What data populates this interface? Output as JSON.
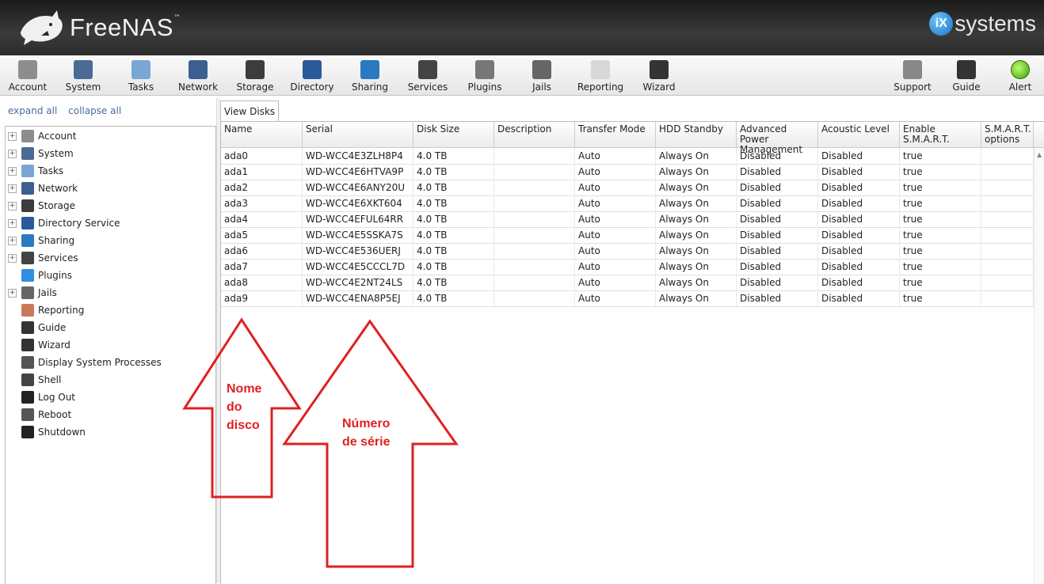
{
  "header": {
    "app_name": "FreeNAS",
    "tm": "™",
    "vendor_mark": "iX",
    "vendor_text": "systems"
  },
  "toolbar": {
    "items": [
      {
        "label": "Account",
        "icon": "account-icon",
        "color": "#8d8d8d"
      },
      {
        "label": "System",
        "icon": "system-icon",
        "color": "#4b6b95"
      },
      {
        "label": "Tasks",
        "icon": "tasks-icon",
        "color": "#7aa6d6"
      },
      {
        "label": "Network",
        "icon": "network-icon",
        "color": "#3d5f8f"
      },
      {
        "label": "Storage",
        "icon": "storage-icon",
        "color": "#3c3c3c"
      },
      {
        "label": "Directory",
        "icon": "directory-icon",
        "color": "#2a5a9a"
      },
      {
        "label": "Sharing",
        "icon": "sharing-icon",
        "color": "#2a7abf"
      },
      {
        "label": "Services",
        "icon": "services-icon",
        "color": "#444444"
      },
      {
        "label": "Plugins",
        "icon": "plugins-icon",
        "color": "#777777"
      },
      {
        "label": "Jails",
        "icon": "jails-icon",
        "color": "#666666"
      },
      {
        "label": "Reporting",
        "icon": "reporting-icon",
        "color": "#d8d8d8"
      },
      {
        "label": "Wizard",
        "icon": "wizard-icon",
        "color": "#333333"
      }
    ],
    "right_items": [
      {
        "label": "Support",
        "icon": "support-icon",
        "color": "#888888"
      },
      {
        "label": "Guide",
        "icon": "guide-icon",
        "color": "#333333"
      },
      {
        "label": "Alert",
        "icon": "alert-icon",
        "color": "#6cd02a"
      }
    ]
  },
  "tree": {
    "expand_all": "expand all",
    "collapse_all": "collapse all",
    "items": [
      {
        "label": "Account",
        "icon": "account-icon",
        "expandable": true,
        "color": "#8d8d8d"
      },
      {
        "label": "System",
        "icon": "system-icon",
        "expandable": true,
        "color": "#4b6b95"
      },
      {
        "label": "Tasks",
        "icon": "tasks-icon",
        "expandable": true,
        "color": "#7aa6d6"
      },
      {
        "label": "Network",
        "icon": "network-icon",
        "expandable": true,
        "color": "#3d5f8f"
      },
      {
        "label": "Storage",
        "icon": "storage-icon",
        "expandable": true,
        "color": "#3c3c3c"
      },
      {
        "label": "Directory Service",
        "icon": "directory-icon",
        "expandable": true,
        "color": "#2a5a9a"
      },
      {
        "label": "Sharing",
        "icon": "sharing-icon",
        "expandable": true,
        "color": "#2a7abf"
      },
      {
        "label": "Services",
        "icon": "services-icon",
        "expandable": true,
        "color": "#444444"
      },
      {
        "label": "Plugins",
        "icon": "plugins-icon",
        "expandable": false,
        "color": "#2f8fe0"
      },
      {
        "label": "Jails",
        "icon": "jails-icon",
        "expandable": true,
        "color": "#666666"
      },
      {
        "label": "Reporting",
        "icon": "reporting-icon",
        "expandable": false,
        "color": "#c97a5a"
      },
      {
        "label": "Guide",
        "icon": "guide-icon",
        "expandable": false,
        "color": "#333333"
      },
      {
        "label": "Wizard",
        "icon": "wizard-icon",
        "expandable": false,
        "color": "#333333"
      },
      {
        "label": "Display System Processes",
        "icon": "processes-icon",
        "expandable": false,
        "color": "#555555"
      },
      {
        "label": "Shell",
        "icon": "shell-icon",
        "expandable": false,
        "color": "#444444"
      },
      {
        "label": "Log Out",
        "icon": "logout-icon",
        "expandable": false,
        "color": "#222222"
      },
      {
        "label": "Reboot",
        "icon": "reboot-icon",
        "expandable": false,
        "color": "#555555"
      },
      {
        "label": "Shutdown",
        "icon": "shutdown-icon",
        "expandable": false,
        "color": "#222222"
      }
    ]
  },
  "tab": {
    "label": "View Disks"
  },
  "table": {
    "columns": [
      "Name",
      "Serial",
      "Disk Size",
      "Description",
      "Transfer Mode",
      "HDD Standby",
      "Advanced Power Management",
      "Acoustic Level",
      "Enable S.M.A.R.T.",
      "S.M.A.R.T. options"
    ],
    "rows": [
      [
        "ada0",
        "WD-WCC4E3ZLH8P4",
        "4.0 TB",
        "",
        "Auto",
        "Always On",
        "Disabled",
        "Disabled",
        "true",
        ""
      ],
      [
        "ada1",
        "WD-WCC4E6HTVA9P",
        "4.0 TB",
        "",
        "Auto",
        "Always On",
        "Disabled",
        "Disabled",
        "true",
        ""
      ],
      [
        "ada2",
        "WD-WCC4E6ANY20U",
        "4.0 TB",
        "",
        "Auto",
        "Always On",
        "Disabled",
        "Disabled",
        "true",
        ""
      ],
      [
        "ada3",
        "WD-WCC4E6XKT604",
        "4.0 TB",
        "",
        "Auto",
        "Always On",
        "Disabled",
        "Disabled",
        "true",
        ""
      ],
      [
        "ada4",
        "WD-WCC4EFUL64RR",
        "4.0 TB",
        "",
        "Auto",
        "Always On",
        "Disabled",
        "Disabled",
        "true",
        ""
      ],
      [
        "ada5",
        "WD-WCC4E5SSKA7S",
        "4.0 TB",
        "",
        "Auto",
        "Always On",
        "Disabled",
        "Disabled",
        "true",
        ""
      ],
      [
        "ada6",
        "WD-WCC4E536UERJ",
        "4.0 TB",
        "",
        "Auto",
        "Always On",
        "Disabled",
        "Disabled",
        "true",
        ""
      ],
      [
        "ada7",
        "WD-WCC4E5CCCL7D",
        "4.0 TB",
        "",
        "Auto",
        "Always On",
        "Disabled",
        "Disabled",
        "true",
        ""
      ],
      [
        "ada8",
        "WD-WCC4E2NT24LS",
        "4.0 TB",
        "",
        "Auto",
        "Always On",
        "Disabled",
        "Disabled",
        "true",
        ""
      ],
      [
        "ada9",
        "WD-WCC4ENA8P5EJ",
        "4.0 TB",
        "",
        "Auto",
        "Always On",
        "Disabled",
        "Disabled",
        "true",
        ""
      ]
    ]
  },
  "annotations": {
    "color": "#e02020",
    "left_lines": [
      "Nome",
      "do",
      "disco"
    ],
    "right_lines": [
      "Número",
      "de série"
    ]
  }
}
